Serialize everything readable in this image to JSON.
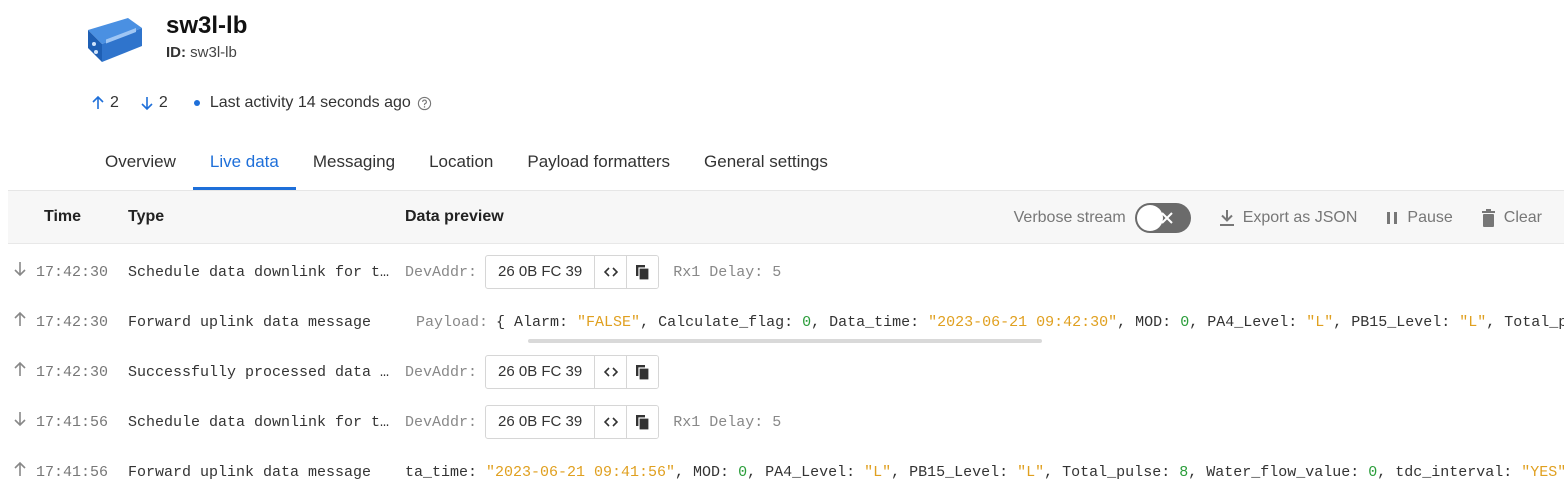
{
  "device": {
    "name": "sw3l-lb",
    "id_label": "ID:",
    "id_value": "sw3l-lb"
  },
  "activity": {
    "uplink_count": "2",
    "downlink_count": "2",
    "last_activity": "Last activity 14 seconds ago"
  },
  "tabs": [
    {
      "label": "Overview",
      "active": false
    },
    {
      "label": "Live data",
      "active": true
    },
    {
      "label": "Messaging",
      "active": false
    },
    {
      "label": "Location",
      "active": false
    },
    {
      "label": "Payload formatters",
      "active": false
    },
    {
      "label": "General settings",
      "active": false
    }
  ],
  "table": {
    "col_time": "Time",
    "col_type": "Type",
    "col_preview": "Data preview"
  },
  "toolbar": {
    "verbose": "Verbose stream",
    "export": "Export as JSON",
    "pause": "Pause",
    "clear": "Clear"
  },
  "colors": {
    "accent": "#1e6fd9",
    "string_value": "#e0a020",
    "number_value": "#2a9d3a"
  },
  "rows": [
    {
      "direction": "down",
      "time": "17:42:30",
      "type": "Schedule data downlink for t…",
      "preview_label": "DevAddr:",
      "devaddr": "26 0B FC 39",
      "extra": "Rx1 Delay: 5"
    },
    {
      "direction": "up",
      "time": "17:42:30",
      "type": "Forward uplink data message",
      "preview_label": "Payload:",
      "payload_prefix": "{ ",
      "payload": [
        {
          "key": "Alarm: ",
          "val": "\"FALSE\"",
          "kind": "s"
        },
        {
          "key": ", Calculate_flag: ",
          "val": "0",
          "kind": "n"
        },
        {
          "key": ", Data_time: ",
          "val": "\"2023-06-21 09:42:30\"",
          "kind": "s"
        },
        {
          "key": ", MOD: ",
          "val": "0",
          "kind": "n"
        },
        {
          "key": ", PA4_Level: ",
          "val": "\"L\"",
          "kind": "s"
        },
        {
          "key": ", PB15_Level: ",
          "val": "\"L\"",
          "kind": "s"
        },
        {
          "key": ", Total_p",
          "val": "",
          "kind": "k"
        }
      ]
    },
    {
      "direction": "up",
      "time": "17:42:30",
      "type": "Successfully processed data …",
      "preview_label": "DevAddr:",
      "devaddr": "26 0B FC 39",
      "extra": ""
    },
    {
      "direction": "down",
      "time": "17:41:56",
      "type": "Schedule data downlink for t…",
      "preview_label": "DevAddr:",
      "devaddr": "26 0B FC 39",
      "extra": "Rx1 Delay: 5"
    },
    {
      "direction": "up",
      "time": "17:41:56",
      "type": "Forward uplink data message",
      "payload_prefix": "ta_time: ",
      "payload": [
        {
          "key": "",
          "val": "\"2023-06-21 09:41:56\"",
          "kind": "s"
        },
        {
          "key": ", MOD: ",
          "val": "0",
          "kind": "n"
        },
        {
          "key": ", PA4_Level: ",
          "val": "\"L\"",
          "kind": "s"
        },
        {
          "key": ", PB15_Level: ",
          "val": "\"L\"",
          "kind": "s"
        },
        {
          "key": ", Total_pulse: ",
          "val": "8",
          "kind": "n"
        },
        {
          "key": ", Water_flow_value: ",
          "val": "0",
          "kind": "n"
        },
        {
          "key": ", tdc_interval: ",
          "val": "\"YES\"",
          "kind": "s"
        }
      ]
    }
  ]
}
